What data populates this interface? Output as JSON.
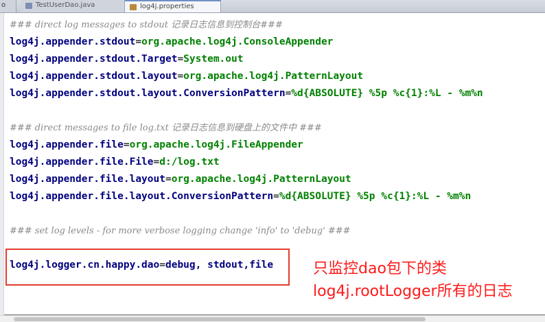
{
  "tabs": [
    {
      "label": "o"
    },
    {
      "label": "TestUserDao.java"
    },
    {
      "label": "log4j.properties"
    }
  ],
  "editor": {
    "lines": {
      "l1": {
        "comment": "### direct log messages to stdout 记录日志信息到控制台###"
      },
      "l2": {
        "key": "log4j.appender.stdout",
        "value": "org.apache.log4j.ConsoleAppender"
      },
      "l3": {
        "key": "log4j.appender.stdout.Target",
        "value": "System.out"
      },
      "l4": {
        "key": "log4j.appender.stdout.layout",
        "value": "org.apache.log4j.PatternLayout"
      },
      "l5": {
        "key": "log4j.appender.stdout.layout.ConversionPattern",
        "value": "%d{ABSOLUTE} %5p %c{1}:%L - %m%n"
      },
      "l7": {
        "comment": "### direct messages to file log.txt 记录日志信息到硬盘上的文件中 ###"
      },
      "l8": {
        "key": "log4j.appender.file",
        "value": "org.apache.log4j.FileAppender"
      },
      "l9": {
        "key": "log4j.appender.file.File",
        "value": "d:/log.txt"
      },
      "l10": {
        "key": "log4j.appender.file.layout",
        "value": "org.apache.log4j.PatternLayout"
      },
      "l11": {
        "key": "log4j.appender.file.layout.ConversionPattern",
        "value": "%d{ABSOLUTE} %5p %c{1}:%L - %m%n"
      },
      "l13": {
        "comment": "### set log levels - for more verbose logging change 'info' to 'debug' ###"
      },
      "l15": {
        "key": "log4j.logger.cn.happy.dao",
        "value": "debug, stdout,file"
      }
    },
    "equals": "="
  },
  "annotations": {
    "line1": "只监控dao包下的类",
    "line2": "log4j.rootLogger所有的日志"
  },
  "colors": {
    "key": "#00007f",
    "value": "#008000",
    "comment": "#8a8a8a",
    "highlight": "#e23c2e",
    "annotation": "#ff1a1a"
  }
}
